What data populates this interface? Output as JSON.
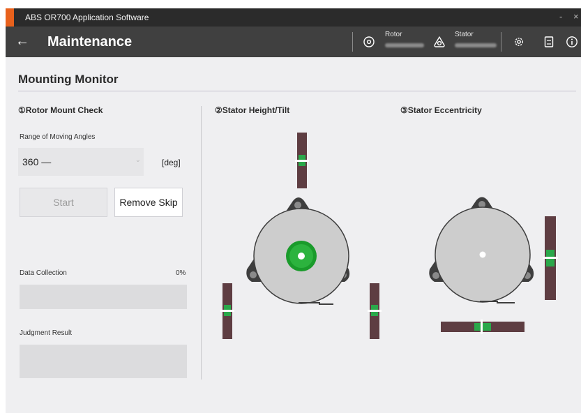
{
  "app": {
    "title": "ABS OR700 Application Software"
  },
  "window_controls": {
    "minimize": "-",
    "close": "×"
  },
  "header": {
    "back_icon": "arrow-left-icon",
    "title": "Maintenance",
    "rotor_label": "Rotor",
    "stator_label": "Stator",
    "icons": [
      "rotor-icon",
      "stator-icon",
      "gear-icon",
      "manual-icon",
      "info-icon"
    ]
  },
  "page": {
    "section_title": "Mounting Monitor",
    "rotor_mount": {
      "title": "①Rotor Mount Check",
      "range_label": "Range of Moving Angles",
      "range_value": "360 —",
      "range_unit": "[deg]",
      "start_label": "Start",
      "remove_skip_label": "Remove Skip",
      "data_collection_label": "Data Collection",
      "data_collection_percent": "0%",
      "data_collection_progress": 0,
      "judgment_label": "Judgment Result"
    },
    "stator_height_tilt": {
      "title": "②Stator Height/Tilt"
    },
    "stator_eccentricity": {
      "title": "③Stator Eccentricity"
    }
  },
  "colors": {
    "accent": "#e8611c",
    "titlebar": "#2b2b2b",
    "header": "#404040",
    "gauge": "#5e3d42",
    "indicator_green": "#2aa84a",
    "target_green": "#1a9b2b"
  }
}
